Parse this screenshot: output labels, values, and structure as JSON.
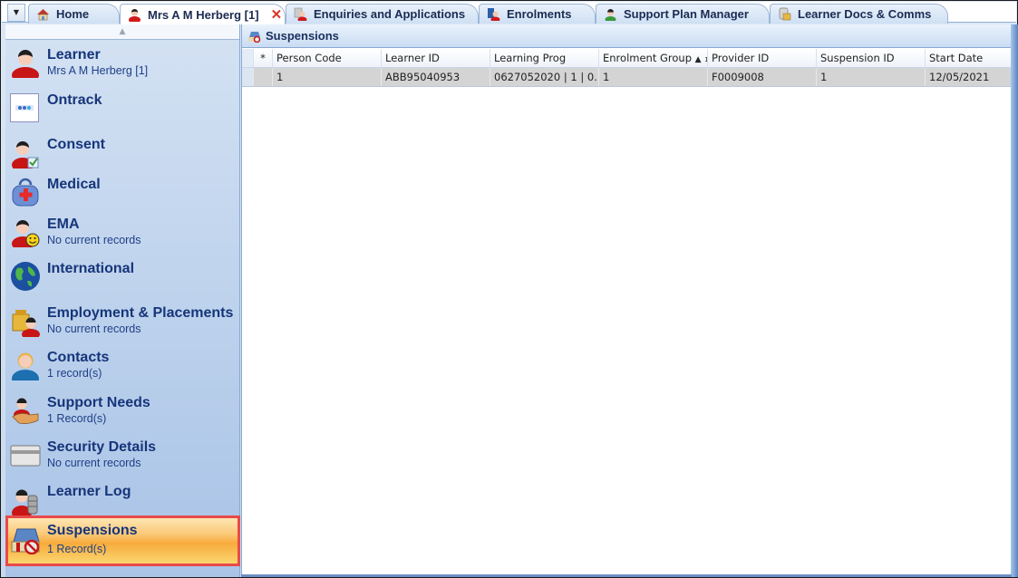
{
  "tabs": {
    "menu_icon": "dropdown-arrow",
    "items": [
      {
        "label": "Home",
        "icon": "home-icon",
        "active": false
      },
      {
        "label": "Mrs A M Herberg [1]",
        "icon": "learner-icon",
        "active": true,
        "close": "✕"
      },
      {
        "label": "Enquiries and Applications",
        "icon": "enquiries-icon",
        "active": false
      },
      {
        "label": "Enrolments",
        "icon": "enrolments-icon",
        "active": false
      },
      {
        "label": "Support Plan Manager",
        "icon": "support-plan-icon",
        "active": false
      },
      {
        "label": "Learner Docs & Comms",
        "icon": "learner-docs-icon",
        "active": false
      }
    ]
  },
  "sidebar": {
    "scroll_up": "▲",
    "items": [
      {
        "title": "Learner",
        "subtitle": "Mrs A M Herberg [1]"
      },
      {
        "title": "Ontrack",
        "subtitle": ""
      },
      {
        "title": "Consent",
        "subtitle": ""
      },
      {
        "title": "Medical",
        "subtitle": ""
      },
      {
        "title": "EMA",
        "subtitle": "No current records"
      },
      {
        "title": "International",
        "subtitle": ""
      },
      {
        "title": "Employment & Placements",
        "subtitle": "No current records"
      },
      {
        "title": "Contacts",
        "subtitle": "1 record(s)"
      },
      {
        "title": "Support Needs",
        "subtitle": "1 Record(s)"
      },
      {
        "title": "Security Details",
        "subtitle": "No current records"
      },
      {
        "title": "Learner Log",
        "subtitle": ""
      },
      {
        "title": "Suspensions",
        "subtitle": "1 Record(s)",
        "selected": true
      }
    ]
  },
  "panel": {
    "title": "Suspensions",
    "grid": {
      "new_row_marker": "*",
      "columns": [
        "Person Code",
        "Learner ID",
        "Learning Prog",
        "Enrolment Group",
        "Provider ID",
        "Suspension ID",
        "Start Date"
      ],
      "sort": {
        "column": "Enrolment Group",
        "direction": "▲",
        "order": "1"
      },
      "rows": [
        [
          "1",
          "ABB95040953",
          "0627052020 | 1 | 0...",
          "1",
          "F0009008",
          "1",
          "12/05/2021"
        ]
      ]
    }
  },
  "colors": {
    "selection_border": "#e84a4a",
    "selection_fill": "#f7ab3c",
    "nav_text": "#16357a"
  }
}
